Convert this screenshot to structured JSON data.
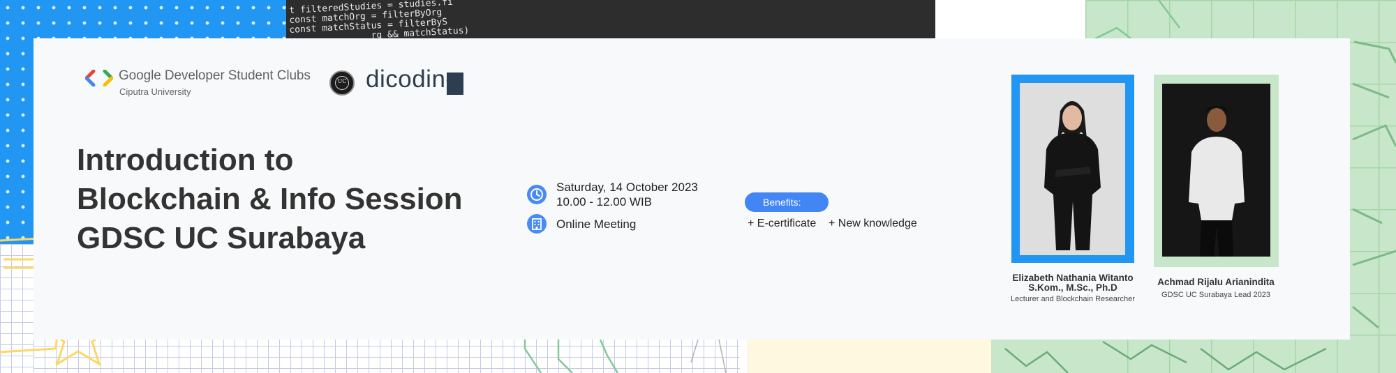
{
  "header": {
    "org_name": "Google Developer Student Clubs",
    "org_university": "Ciputra University",
    "partner_name": "dicoding",
    "seal_text": "UC"
  },
  "event": {
    "title_lines": [
      "Introduction to",
      "Blockchain & Info Session",
      "GDSC UC Surabaya"
    ],
    "date": "Saturday, 14 October 2023",
    "time": "10.00 - 12.00 WIB",
    "location": "Online Meeting",
    "benefits_label": "Benefits:",
    "benefits": [
      "+ E-certificate",
      "+ New knowledge"
    ]
  },
  "speakers": [
    {
      "name_line1": "Elizabeth Nathania Witanto",
      "name_line2": "S.Kom., M.Sc., Ph.D",
      "role": "Lecturer and Blockchain Researcher",
      "frame_color": "#2196f3",
      "photo_bg": "#dedede"
    },
    {
      "name_line1": "Achmad Rijalu Arianindita",
      "name_line2": "",
      "role": "GDSC UC Surabaya Lead 2023",
      "frame_color": "#c8e6c9",
      "photo_bg": "#161616"
    }
  ],
  "background_code": [
    "t filteredStudies = studies.fi",
    "const matchOrg = filterByOrg",
    "const matchStatus = filterByS",
    "               rg && matchStatus)"
  ],
  "colors": {
    "accent_blue": "#4285f4",
    "title": "#333333",
    "card": "#f8f9fa"
  },
  "icons": {
    "date": "clock-icon",
    "location": "building-icon"
  }
}
